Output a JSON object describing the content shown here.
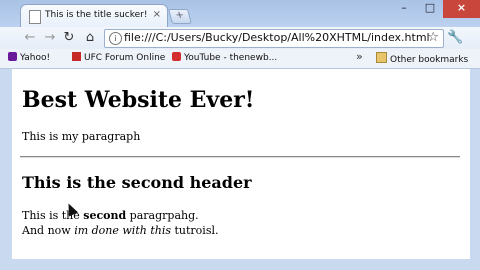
{
  "tab": {
    "title": "This is the title sucker!",
    "close": "×"
  },
  "newtab_label": "+",
  "window_controls": {
    "minimize": "–",
    "maximize": "□",
    "close": "×"
  },
  "nav": {
    "back": "←",
    "forward": "→",
    "reload": "↻",
    "home": "⌂"
  },
  "address": {
    "url": "file:///C:/Users/Bucky/Desktop/All%20XHTML/index.html",
    "icon": "page-icon",
    "star": "☆"
  },
  "wrench_glyph": "🔧",
  "bookmarks": {
    "items": [
      {
        "label": "Yahoo!"
      },
      {
        "label": "UFC Forum Online"
      },
      {
        "label": "YouTube - thenewb..."
      }
    ],
    "chevron": "»",
    "other": "Other bookmarks"
  },
  "page": {
    "h1": "Best Website Ever!",
    "p1": "This is my paragraph",
    "h2": "This is the second header",
    "p2_a": "This is the ",
    "p2_bold": "second",
    "p2_b": " paragrpahg.",
    "p3_a": "And now ",
    "p3_italic": "im done with this",
    "p3_b": " tutroisl."
  },
  "colors": {
    "chrome_frame": "#c9d9ef",
    "close_button": "#c9463d"
  }
}
